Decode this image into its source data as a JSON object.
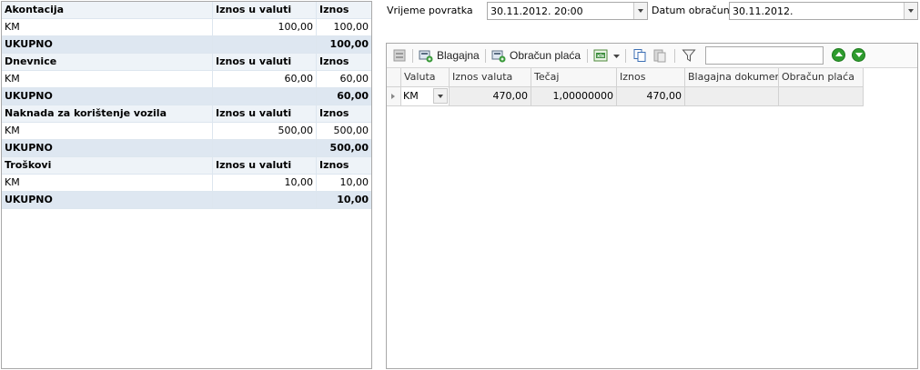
{
  "summary": {
    "sections": [
      {
        "title": "Akontacija",
        "col_iznos_u_valuti": "Iznos u valuti",
        "col_iznos": "Iznos",
        "item_label": "KM",
        "item_iznos_u_valuti": "100,00",
        "item_iznos": "100,00",
        "total_label": "UKUPNO",
        "total_iznos": "100,00"
      },
      {
        "title": "Dnevnice",
        "col_iznos_u_valuti": "Iznos u valuti",
        "col_iznos": "Iznos",
        "item_label": "KM",
        "item_iznos_u_valuti": "60,00",
        "item_iznos": "60,00",
        "total_label": "UKUPNO",
        "total_iznos": "60,00"
      },
      {
        "title": "Naknada za korištenje vozila",
        "col_iznos_u_valuti": "Iznos u valuti",
        "col_iznos": "Iznos",
        "item_label": "KM",
        "item_iznos_u_valuti": "500,00",
        "item_iznos": "500,00",
        "total_label": "UKUPNO",
        "total_iznos": "500,00"
      },
      {
        "title": "Troškovi",
        "col_iznos_u_valuti": "Iznos u valuti",
        "col_iznos": "Iznos",
        "item_label": "KM",
        "item_iznos_u_valuti": "10,00",
        "item_iznos": "10,00",
        "total_label": "UKUPNO",
        "total_iznos": "10,00"
      }
    ]
  },
  "form": {
    "vrijeme_povratka_label": "Vrijeme povratka",
    "vrijeme_povratka_value": "30.11.2012. 20:00",
    "datum_obracuna_label": "Datum obračuna",
    "datum_obracuna_value": "30.11.2012."
  },
  "toolbar": {
    "blagajna_label": "Blagajna",
    "obracun_placa_label": "Obračun plaća",
    "search_value": "",
    "icons": [
      "form-icon",
      "blagajna-icon",
      "obracun-placa-icon",
      "excel-export-icon",
      "copy-icon",
      "paste-icon",
      "filter-icon",
      "move-up-icon",
      "move-down-icon"
    ]
  },
  "grid": {
    "columns": [
      "Valuta",
      "Iznos valuta",
      "Tečaj",
      "Iznos",
      "Blagajna dokument",
      "Obračun plaća"
    ],
    "rows": [
      {
        "valuta": "KM",
        "iznos_valuta": "470,00",
        "tecaj": "1,00000000",
        "iznos": "470,00",
        "blagajna_dokument": "",
        "obracun_placa": ""
      }
    ]
  },
  "colors": {
    "section_header_bg": "#eef3f8",
    "total_row_bg": "#dee7f1",
    "accent_green": "#2e9b2e"
  }
}
